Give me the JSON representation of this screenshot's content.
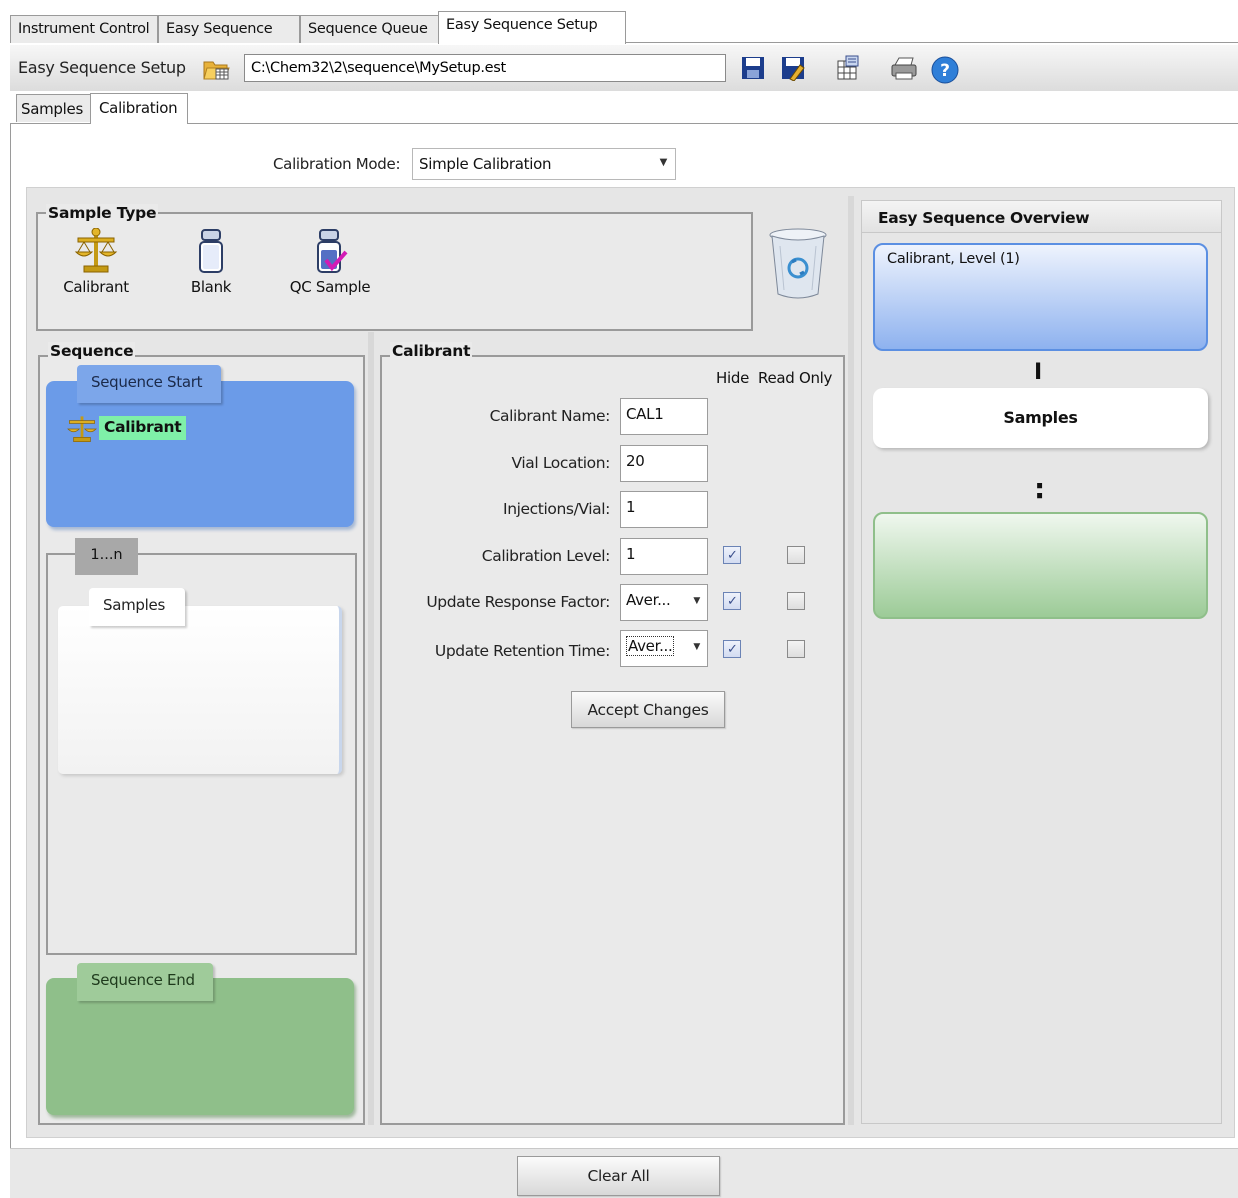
{
  "top_tabs": [
    "Instrument Control",
    "Easy Sequence",
    "Sequence Queue",
    "Easy Sequence Setup"
  ],
  "toolbar": {
    "label": "Easy Sequence Setup",
    "path": "C:\\Chem32\\2\\sequence\\MySetup.est",
    "icons": [
      "open-folder-icon",
      "save-icon",
      "save-as-icon",
      "print-preview-icon",
      "print-icon",
      "help-icon"
    ]
  },
  "sub_tabs": [
    "Samples",
    "Calibration"
  ],
  "calibration_mode": {
    "label": "Calibration Mode:",
    "value": "Simple Calibration"
  },
  "sample_type": {
    "title": "Sample Type",
    "items": [
      "Calibrant",
      "Blank",
      "QC Sample"
    ],
    "trash_icon": "recycle-bin-icon"
  },
  "sequence": {
    "title": "Sequence",
    "start_label": "Sequence Start",
    "calibrant_item": "Calibrant",
    "loop_label": "1...n",
    "samples_label": "Samples",
    "end_label": "Sequence End"
  },
  "calibrant": {
    "title": "Calibrant",
    "col_hide": "Hide",
    "col_read_only": "Read Only",
    "fields": [
      {
        "label": "Calibrant Name:",
        "value": "CAL1"
      },
      {
        "label": "Vial Location:",
        "value": "20"
      },
      {
        "label": "Injections/Vial:",
        "value": "1"
      },
      {
        "label": "Calibration Level:",
        "value": "1",
        "hide": true,
        "read_only": false
      },
      {
        "label": "Update Response Factor:",
        "value": "Aver...",
        "hide": true,
        "read_only": false
      },
      {
        "label": "Update Retention Time:",
        "value": "Aver...",
        "hide": true,
        "read_only": false
      }
    ],
    "accept_button": "Accept Changes"
  },
  "overview": {
    "title": "Easy Sequence Overview",
    "first_block": "Calibrant, Level (1)",
    "samples_block": "Samples",
    "connector": "I",
    "ellipsis": ":"
  },
  "footer": {
    "clear_button": "Clear All"
  },
  "colors": {
    "start_blue": "#6b9be8",
    "end_green": "#8fbf8a",
    "highlight_green": "#7ff0a8"
  }
}
